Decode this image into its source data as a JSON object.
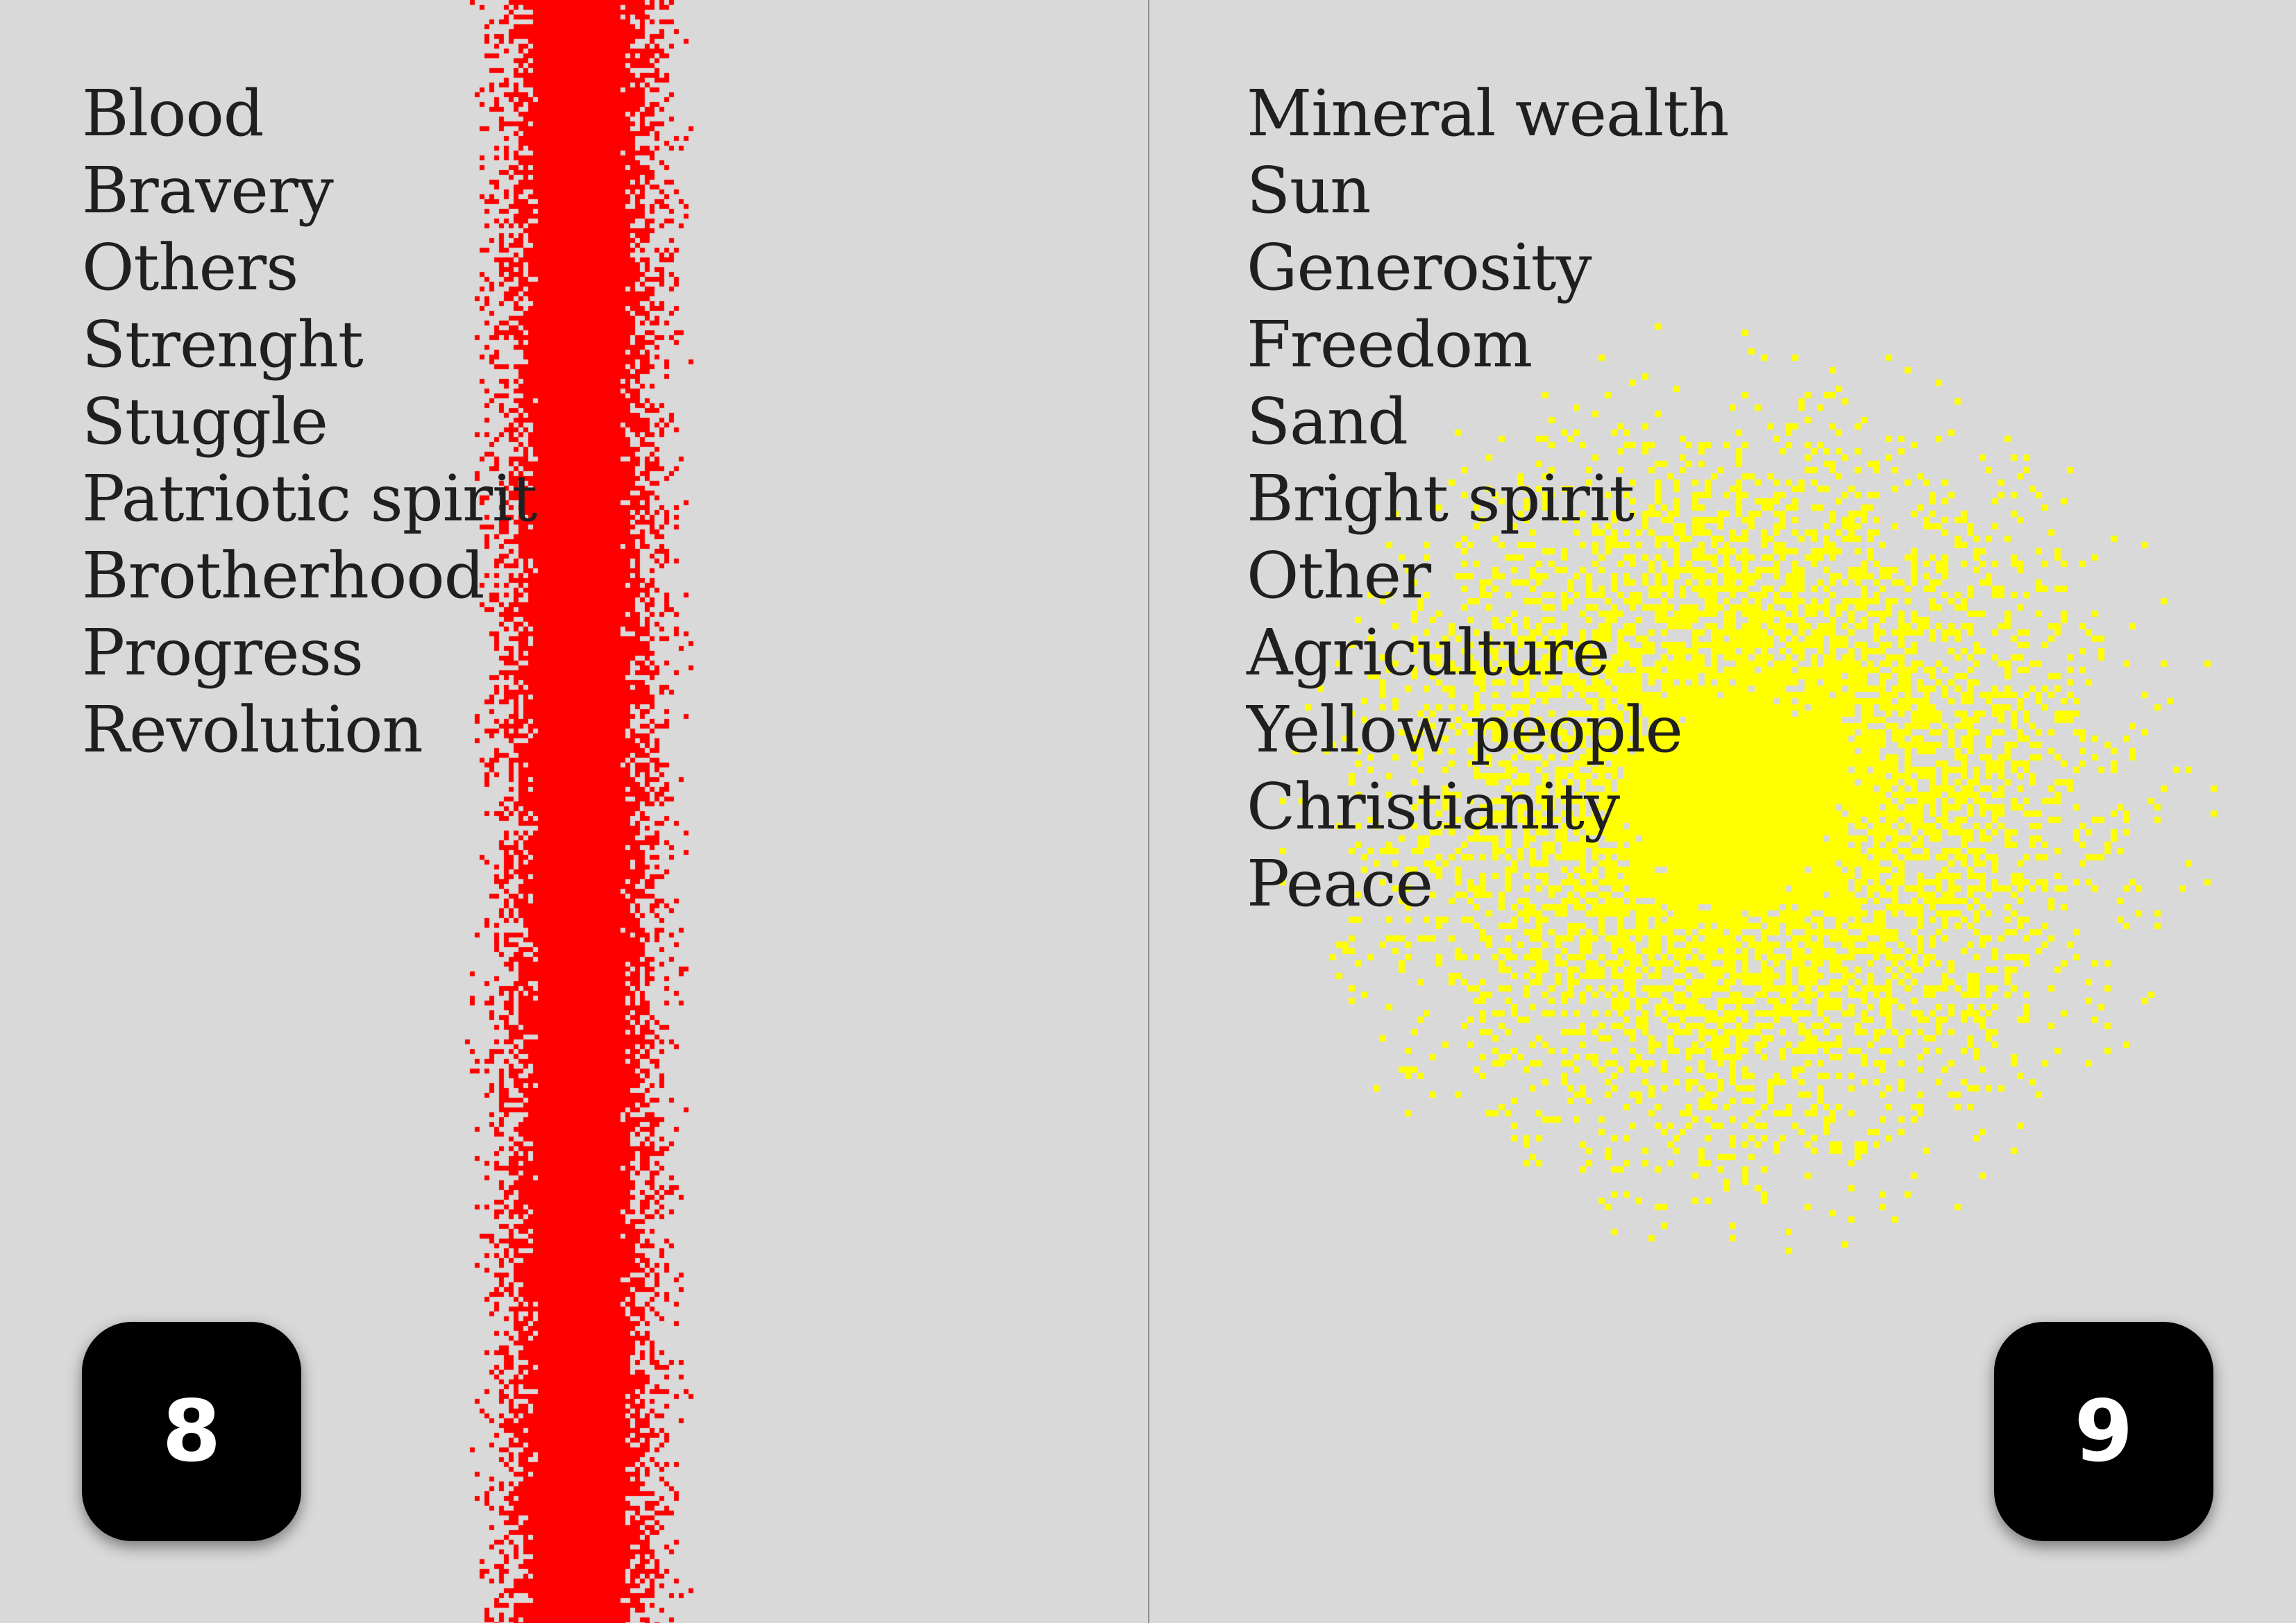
{
  "left_page": {
    "words": [
      "Blood",
      "Bravery",
      "Others",
      "Strenght",
      "Stuggle",
      "Patriotic spirit",
      "Brotherhood",
      "Progress",
      "Revolution"
    ],
    "page_number": "8",
    "accent_color": "#ff0000"
  },
  "right_page": {
    "words": [
      "Mineral wealth",
      "Sun",
      "Generosity",
      "Freedom",
      "Sand",
      "Bright spirit",
      "Other",
      "Agriculture",
      "Yellow people",
      "Christianity",
      "Peace"
    ],
    "page_number": "9",
    "accent_color": "#ffff00"
  },
  "colors": {
    "paper": "#d9d9d9",
    "text": "#1f1f1f",
    "folio_box": "#000000",
    "folio_text": "#ffffff"
  }
}
